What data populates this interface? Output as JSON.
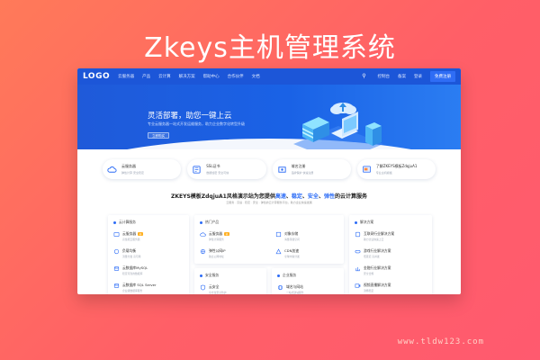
{
  "banner": {
    "title": "Zkeys主机管理系统"
  },
  "nav": {
    "logo": "LOGO",
    "items": [
      "云服务器",
      "产品",
      "云计算",
      "解决方案",
      "帮助中心",
      "合作伙伴",
      "文档"
    ],
    "right_items": [
      "控制台",
      "备案",
      "登录"
    ],
    "cta": "免费注册"
  },
  "hero": {
    "title": "灵活部署，助您一键上云",
    "subtitle": "专业云服务器一站式开发运维服务，助力企业数字化转型升级",
    "button": "立即购买"
  },
  "features": [
    {
      "icon": "cloud-icon",
      "title": "云服务器",
      "desc": "弹性计算 安全稳定"
    },
    {
      "icon": "ssl-icon",
      "title": "SSL证书",
      "desc": "数据加密 安全可信"
    },
    {
      "icon": "domain-icon",
      "title": "域名注册",
      "desc": "品牌保护 快速注册"
    },
    {
      "icon": "template-icon",
      "title": "了解ZKEYS模板ZdqjuA1",
      "desc": "专业主机模板"
    }
  ],
  "section": {
    "title_prefix": "ZKEYS模板ZdqjuA1风格演示站为您提供",
    "hl1": "高速",
    "hl2": "稳定",
    "hl3": "安全",
    "hl4": "弹性",
    "title_suffix": "的云计算服务",
    "sep": "、",
    "subtitle": "云服务 · 高速 · 稳定 · 安全 · 弹性的云计算服务平台，助力企业快速发展"
  },
  "panels": {
    "left": {
      "head": "云计算服务",
      "rows": [
        {
          "title": "云服务器",
          "tag": "热",
          "desc": "高性能云服务器"
        },
        {
          "title": "负载均衡",
          "desc": "流量分发 高可用"
        },
        {
          "title": "云数据库MySQL",
          "desc": "稳定可靠的数据库"
        },
        {
          "title": "云数据库 SQL Server",
          "desc": "企业级数据库服务"
        }
      ]
    },
    "middle": {
      "head": "热门产品",
      "rows": [
        {
          "title": "云服务器",
          "tag": "热",
          "desc": "弹性计算服务"
        },
        {
          "title": "弹性公网IP",
          "desc": "独立公网地址"
        },
        {
          "title": "对象存储",
          "desc": "海量存储空间"
        },
        {
          "title": "CDN加速",
          "desc": "全球内容分发"
        }
      ]
    },
    "mid_bottom_left": {
      "head": "安全服务",
      "row": {
        "title": "云安全",
        "desc": "全方位安全防护"
      }
    },
    "mid_bottom_right": {
      "head": "企业服务",
      "row": {
        "title": "域名与网站",
        "desc": "一站式建站服务"
      }
    },
    "right": {
      "head": "解决方案",
      "rows": [
        {
          "title": "互联网行业解决方案",
          "desc": "助力企业快速上云"
        },
        {
          "title": "游戏行业解决方案",
          "desc": "低延迟 高并发"
        },
        {
          "title": "金融行业解决方案",
          "desc": "安全合规"
        },
        {
          "title": "视频直播解决方案",
          "desc": "流畅稳定"
        }
      ]
    }
  },
  "watermark": "www.tldw123.com",
  "colors": {
    "brand": "#1c56d8",
    "accent": "#2c6cf6",
    "banner_bg": "#ff6a5e"
  }
}
